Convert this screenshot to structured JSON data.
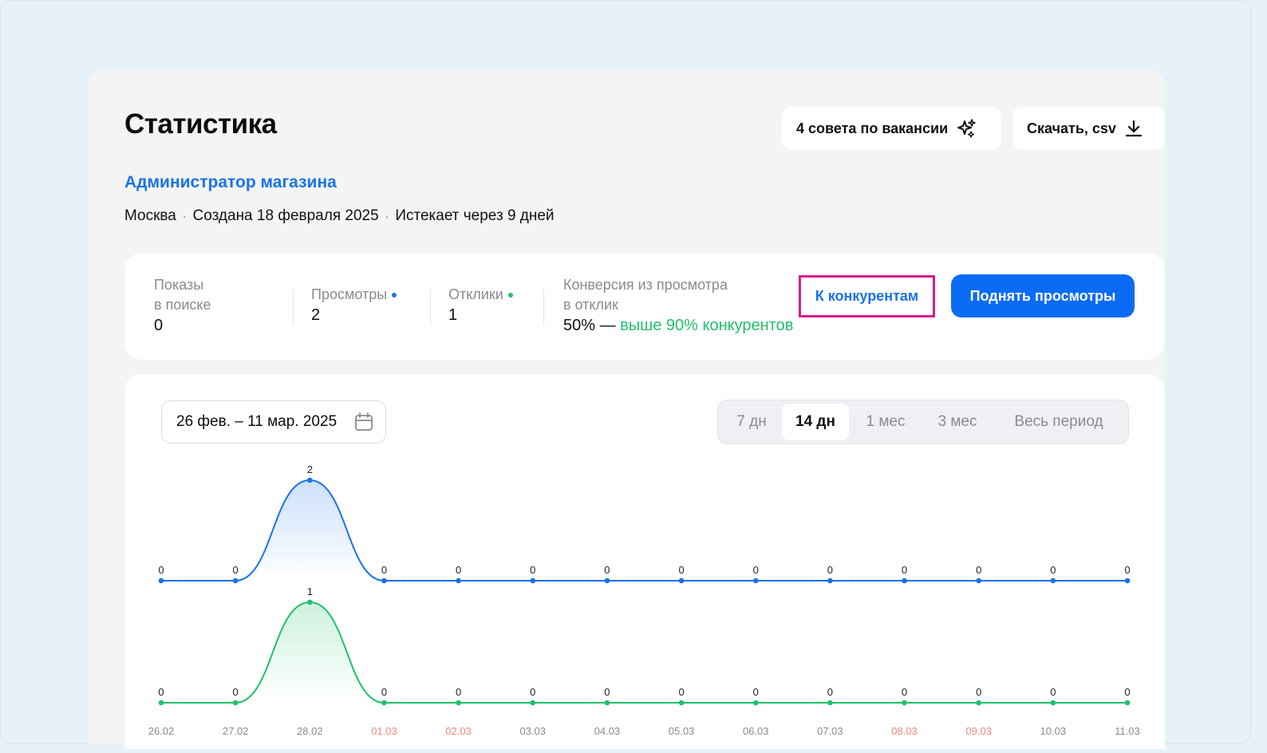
{
  "header": {
    "title": "Статистика",
    "tips_button": "4 совета по вакансии",
    "download_button": "Скачать, csv"
  },
  "vacancy": {
    "name": "Администратор магазина",
    "city": "Москва",
    "created": "Создана 18 февраля 2025",
    "expires": "Истекает через 9 дней"
  },
  "stats": {
    "shows_label_1": "Показы",
    "shows_label_2": "в поиске",
    "shows_value": "0",
    "views_label": "Просмотры",
    "views_value": "2",
    "responses_label": "Отклики",
    "responses_value": "1",
    "conv_label_1": "Конверсия из просмотра",
    "conv_label_2": "в отклик",
    "conv_value": "50% —",
    "conv_note": "выше 90% конкурентов",
    "competitors_button": "К конкурентам",
    "raise_button": "Поднять просмотры"
  },
  "filters": {
    "date_range": "26 фев. – 11 мар. 2025",
    "periods": [
      "7 дн",
      "14 дн",
      "1 мес",
      "3 мес",
      "Весь период"
    ],
    "active_period": "14 дн"
  },
  "colors": {
    "views": "#1a73e8",
    "responses": "#21c06b",
    "weekend": "#f2867a",
    "accent": "#0a6cf5",
    "highlight": "#d81b8d"
  },
  "chart_data": {
    "type": "line",
    "categories": [
      "26.02",
      "27.02",
      "28.02",
      "01.03",
      "02.03",
      "03.03",
      "04.03",
      "05.03",
      "06.03",
      "07.03",
      "08.03",
      "09.03",
      "10.03",
      "11.03"
    ],
    "weekend": [
      "01.03",
      "02.03",
      "08.03",
      "09.03"
    ],
    "series": [
      {
        "name": "Просмотры",
        "values": [
          0,
          0,
          2,
          0,
          0,
          0,
          0,
          0,
          0,
          0,
          0,
          0,
          0,
          0
        ]
      },
      {
        "name": "Отклики",
        "values": [
          0,
          0,
          1,
          0,
          0,
          0,
          0,
          0,
          0,
          0,
          0,
          0,
          0,
          0
        ]
      }
    ]
  }
}
